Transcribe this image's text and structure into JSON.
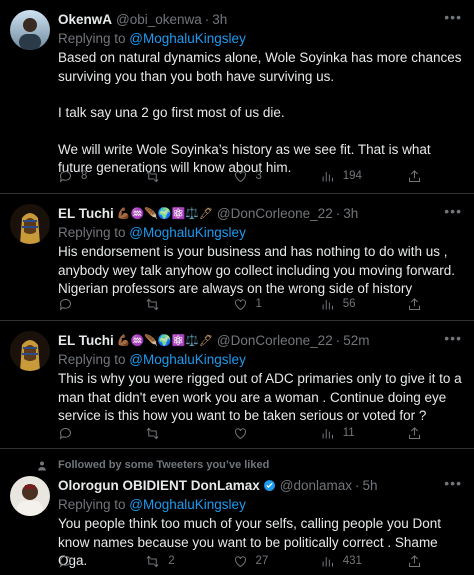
{
  "tweets": [
    {
      "name": "OkenwA",
      "handle": "@obi_okenwa",
      "time": "3h",
      "replying_prefix": "Replying to ",
      "replying_to": "@MoghaluKingsley",
      "body": [
        "Based on natural dynamics alone, Wole Soyinka has more chances surviving you than you both have surviving us.",
        "I talk say una 2 go first most of us die.",
        "We will write Wole Soyinka’s history as we see fit. That is what future generations will know about him."
      ],
      "replies": "8",
      "retweets": "",
      "likes": "3",
      "views": "194"
    },
    {
      "name": "EL Tuchi",
      "emojis": "💪🏾♒️🪶🌍⚛️⚖️🖊",
      "handle": "@DonCorleone_22",
      "time": "3h",
      "replying_prefix": "Replying to ",
      "replying_to": "@MoghaluKingsley",
      "body": [
        "His endorsement is your business and has nothing to do with us , anybody wey talk anyhow go collect including you moving forward. Nigerian professors are always on the wrong side of history"
      ],
      "replies": "",
      "retweets": "",
      "likes": "1",
      "views": "56"
    },
    {
      "name": "EL Tuchi",
      "emojis": "💪🏾♒️🪶🌍⚛️⚖️🖊",
      "handle": "@DonCorleone_22",
      "time": "52m",
      "replying_prefix": "Replying to ",
      "replying_to": "@MoghaluKingsley",
      "body": [
        "This is why you were rigged out of ADC primaries only to give it to a man that didn't even work you are a woman . Continue doing eye service is this how you want to be taken serious or voted for ?"
      ],
      "replies": "",
      "retweets": "",
      "likes": "",
      "views": "11"
    },
    {
      "liked_by": "Followed by some Tweeters you’ve liked",
      "name": "Olorogun OBIDIENT DonLamax",
      "handle": "@donlamax",
      "time": "5h",
      "replying_prefix": "Replying to ",
      "replying_to": "@MoghaluKingsley",
      "body": [
        "You people think too much of your selfs, calling people you Dont know names because you want to be politically correct . Shame Oga."
      ],
      "replies": "",
      "retweets": "2",
      "likes": "27",
      "views": "431"
    }
  ],
  "icons": {
    "reply": "reply-icon",
    "retweet": "retweet-icon",
    "like": "heart-icon",
    "views": "views-icon",
    "share": "share-icon",
    "more": "more-icon",
    "verified": "verified-badge-icon"
  },
  "colors": {
    "background": "#000000",
    "text": "#e7e9ea",
    "muted": "#71767b",
    "link": "#1d9bf0",
    "divider": "#2f3336"
  }
}
